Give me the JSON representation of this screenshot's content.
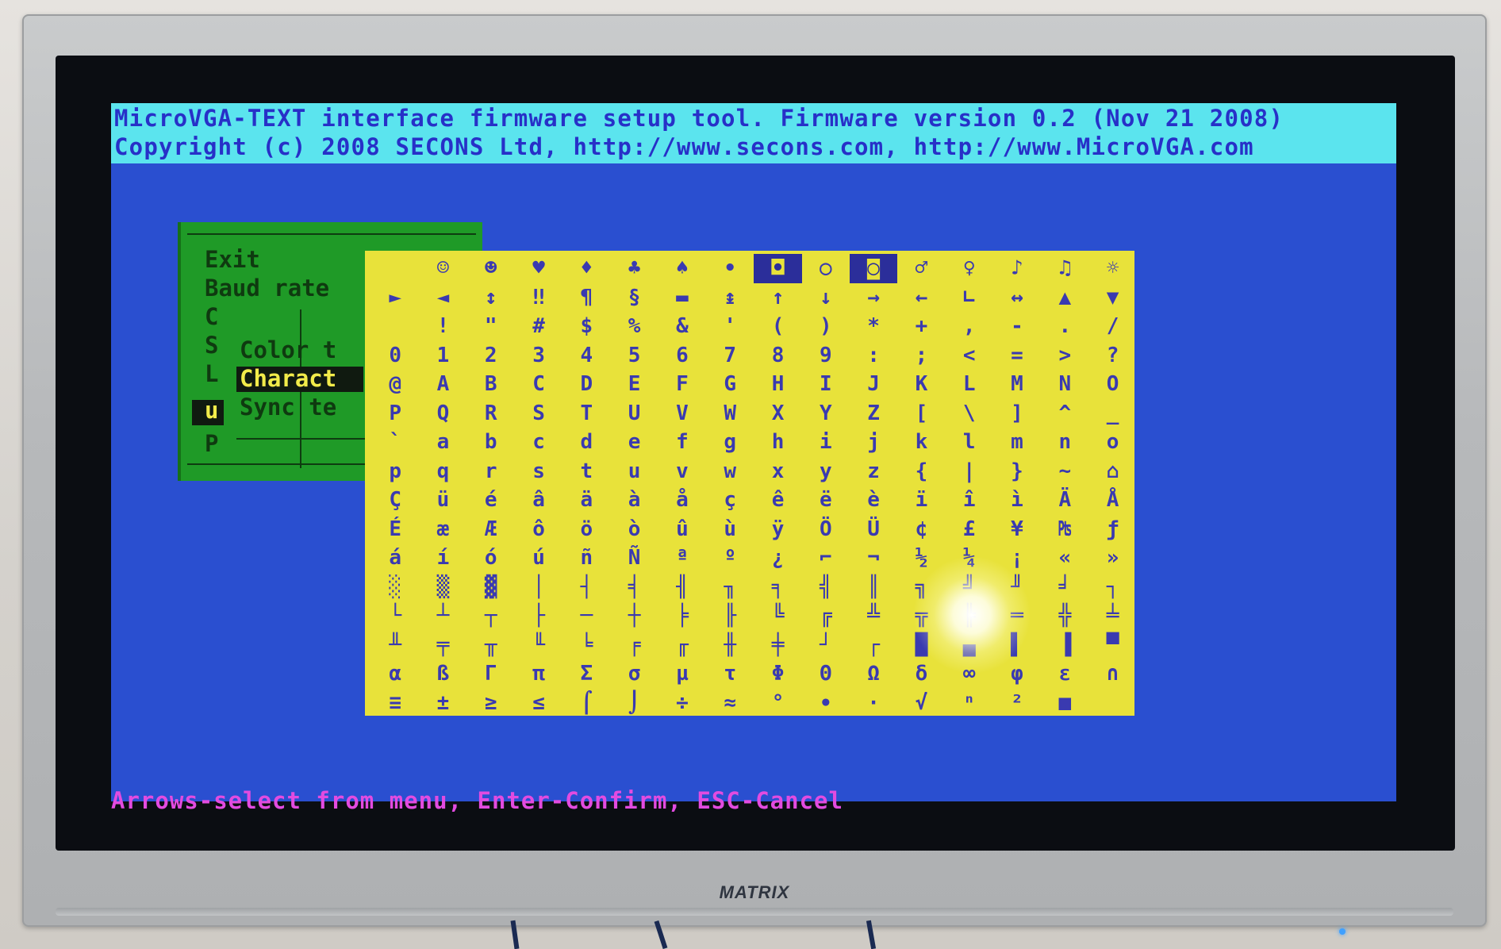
{
  "header": {
    "line1": "MicroVGA-TEXT interface firmware setup tool. Firmware version 0.2 (Nov 21 2008)",
    "line2": "Copyright (c) 2008 SECONS Ltd, http://www.secons.com, http://www.MicroVGA.com"
  },
  "menu": {
    "items": [
      {
        "label": "Exit"
      },
      {
        "label": "Baud rate"
      },
      {
        "label": "C"
      },
      {
        "label": "S"
      },
      {
        "label": "L"
      },
      {
        "label": "u"
      },
      {
        "label": "P"
      }
    ],
    "submenu": [
      {
        "label": "Color t"
      },
      {
        "label": "Charact"
      },
      {
        "label": "Sync te"
      }
    ]
  },
  "char_rows": [
    [
      " ",
      "☺",
      "☻",
      "♥",
      "♦",
      "♣",
      "♠",
      "•",
      "◘",
      "○",
      "◙",
      "♂",
      "♀",
      "♪",
      "♫",
      "☼"
    ],
    [
      "►",
      "◄",
      "↕",
      "‼",
      "¶",
      "§",
      "▬",
      "↨",
      "↑",
      "↓",
      "→",
      "←",
      "∟",
      "↔",
      "▲",
      "▼"
    ],
    [
      " ",
      "!",
      "\"",
      "#",
      "$",
      "%",
      "&",
      "'",
      "(",
      ")",
      "*",
      "+",
      ",",
      "-",
      ".",
      "/"
    ],
    [
      "0",
      "1",
      "2",
      "3",
      "4",
      "5",
      "6",
      "7",
      "8",
      "9",
      ":",
      ";",
      "<",
      "=",
      ">",
      "?"
    ],
    [
      "@",
      "A",
      "B",
      "C",
      "D",
      "E",
      "F",
      "G",
      "H",
      "I",
      "J",
      "K",
      "L",
      "M",
      "N",
      "O"
    ],
    [
      "P",
      "Q",
      "R",
      "S",
      "T",
      "U",
      "V",
      "W",
      "X",
      "Y",
      "Z",
      "[",
      "\\",
      "]",
      "^",
      "_"
    ],
    [
      "`",
      "a",
      "b",
      "c",
      "d",
      "e",
      "f",
      "g",
      "h",
      "i",
      "j",
      "k",
      "l",
      "m",
      "n",
      "o"
    ],
    [
      "p",
      "q",
      "r",
      "s",
      "t",
      "u",
      "v",
      "w",
      "x",
      "y",
      "z",
      "{",
      "|",
      "}",
      "~",
      "⌂"
    ],
    [
      "Ç",
      "ü",
      "é",
      "â",
      "ä",
      "à",
      "å",
      "ç",
      "ê",
      "ë",
      "è",
      "ï",
      "î",
      "ì",
      "Ä",
      "Å"
    ],
    [
      "É",
      "æ",
      "Æ",
      "ô",
      "ö",
      "ò",
      "û",
      "ù",
      "ÿ",
      "Ö",
      "Ü",
      "¢",
      "£",
      "¥",
      "₧",
      "ƒ"
    ],
    [
      "á",
      "í",
      "ó",
      "ú",
      "ñ",
      "Ñ",
      "ª",
      "º",
      "¿",
      "⌐",
      "¬",
      "½",
      "¼",
      "¡",
      "«",
      "»"
    ],
    [
      "░",
      "▒",
      "▓",
      "│",
      "┤",
      "╡",
      "╢",
      "╖",
      "╕",
      "╣",
      "║",
      "╗",
      "╝",
      "╜",
      "╛",
      "┐"
    ],
    [
      "└",
      "┴",
      "┬",
      "├",
      "─",
      "┼",
      "╞",
      "╟",
      "╚",
      "╔",
      "╩",
      "╦",
      "╠",
      "═",
      "╬",
      "╧"
    ],
    [
      "╨",
      "╤",
      "╥",
      "╙",
      "╘",
      "╒",
      "╓",
      "╫",
      "╪",
      "┘",
      "┌",
      "█",
      "▄",
      "▌",
      "▐",
      "▀"
    ],
    [
      "α",
      "ß",
      "Γ",
      "π",
      "Σ",
      "σ",
      "µ",
      "τ",
      "Φ",
      "Θ",
      "Ω",
      "δ",
      "∞",
      "φ",
      "ε",
      "∩"
    ],
    [
      "≡",
      "±",
      "≥",
      "≤",
      "⌠",
      "⌡",
      "÷",
      "≈",
      "°",
      "∙",
      "·",
      "√",
      "ⁿ",
      "²",
      "■",
      " "
    ]
  ],
  "highlight_cells": [
    "0-8",
    "0-10"
  ],
  "status": {
    "text": "Arrows-select from menu, Enter-Confirm, ESC-Cancel"
  },
  "monitor": {
    "brand": "MATRIX"
  },
  "colors": {
    "screen_bg": "#2a4fd0",
    "title_bg": "#5be4ee",
    "title_fg": "#2730c8",
    "menu_bg": "#1f9a27",
    "grid_bg": "#e8e23a",
    "status_fg": "#e24be0"
  }
}
